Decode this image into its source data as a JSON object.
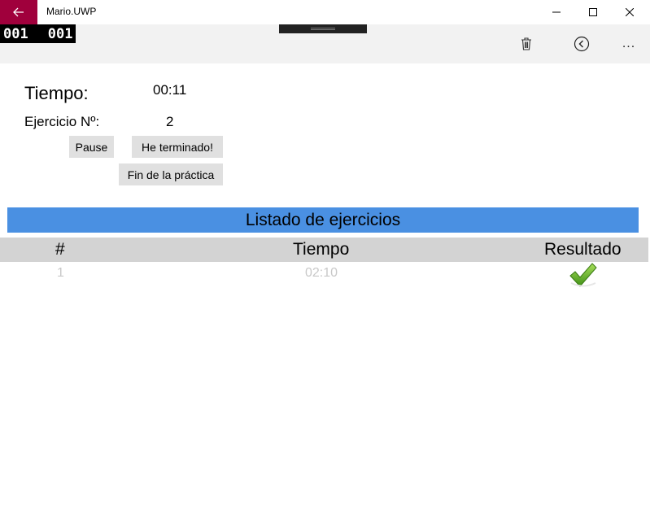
{
  "window": {
    "title": "Mario.UWP"
  },
  "counters": [
    "001",
    "001"
  ],
  "command_bar": {
    "more_label": "..."
  },
  "info": {
    "tiempo_label": "Tiempo:",
    "tiempo_value": "00:11",
    "ejercicio_label": "Ejercicio Nº:",
    "ejercicio_value": "2"
  },
  "buttons": {
    "pause": "Pause",
    "done": "He terminado!",
    "end": "Fin de la práctica"
  },
  "list": {
    "title": "Listado de ejercicios",
    "columns": [
      "#",
      "Tiempo",
      "Resultado"
    ],
    "rows": [
      {
        "num": "1",
        "time": "02:10",
        "result": "check-icon"
      }
    ]
  },
  "colors": {
    "back_button": "#a0003c",
    "list_header": "#4a90e2",
    "column_header": "#d3d3d3",
    "command_bar": "#f2f2f2",
    "check": "#6fbf2a"
  }
}
